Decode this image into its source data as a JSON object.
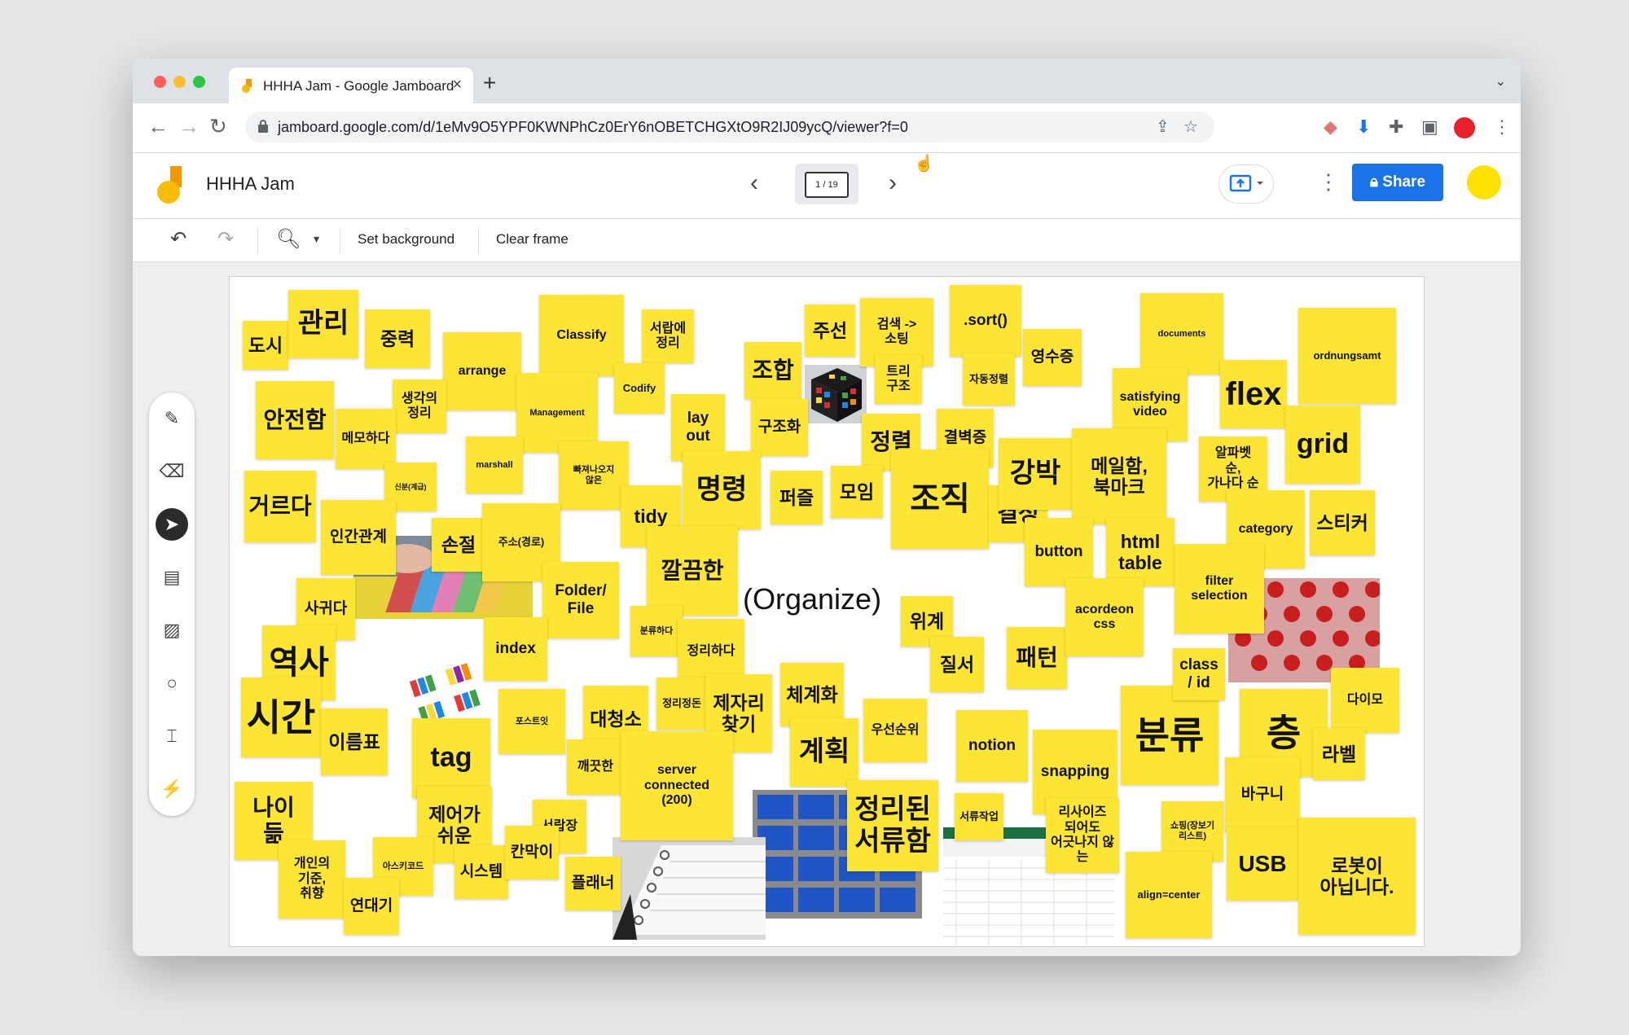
{
  "browser": {
    "tab_title": "HHHA Jam - Google Jamboard",
    "url": "jamboard.google.com/d/1eMv9O5YPF0KWNPhCz0ErY6nOBETCHGXtO9R2IJ09ycQ/viewer?f=0",
    "icons": [
      "back-icon",
      "forward-icon",
      "reload-icon",
      "lock-icon",
      "share-page-icon",
      "bookmark-star-icon",
      "extension-icon",
      "download-icon",
      "puzzle-icon",
      "sidepanel-icon",
      "profile-icon",
      "menu-icon"
    ]
  },
  "app": {
    "title": "HHHA Jam",
    "frame_indicator": "1 / 19",
    "share_label": "Share",
    "accent": "#1a73e8",
    "note_color": "#fde533"
  },
  "toolbar": {
    "set_background": "Set background",
    "clear_frame": "Clear frame"
  },
  "canvas": {
    "center_text": "(Organize)",
    "notes": [
      "도시",
      "관리",
      "중력",
      "arrange",
      "Classify",
      "서랍에\n정리",
      "Codify",
      "주선",
      "검색 ->\n소팅",
      ".sort()",
      "영수증",
      "documents",
      "ordnungsamt",
      "안전함",
      "생각의\n정리",
      "메모하다",
      "Management",
      "marshall",
      "빠져나오지\n않은",
      "lay\nout",
      "조합",
      "구조화",
      "트리\n구조",
      "자동정렬",
      "정렬",
      "결벽증",
      "satisfying\nvideo",
      "flex",
      "알파벳\n순,\n가나다 순",
      "grid",
      "거르다",
      "신분(계급)",
      "인간관계",
      "손절",
      "주소(경로)",
      "tidy",
      "명령",
      "퍼즐",
      "모임",
      "조직",
      "결성",
      "강박",
      "메일함,\n북마크",
      "button",
      "html\ntable",
      "category",
      "스티커",
      "사귀다",
      "Folder/\nFile",
      "깔끔한",
      "분류하다",
      "정리하다",
      "위계",
      "질서",
      "패턴",
      "acordeon\ncss",
      "filter\nselection",
      "역사",
      "index",
      "시간",
      "이름표",
      "tag",
      "포스트잇",
      "대청소",
      "정리정돈",
      "제자리\n찾기",
      "체계화",
      "계획",
      "우선순위",
      "notion",
      "snapping",
      "분류",
      "층",
      "class\n/ id",
      "다이모",
      "라벨",
      "나이\n듦",
      "깨끗한",
      "server\nconnected\n(200)",
      "서랍장",
      "제어가\n쉬운",
      "개인의\n기준,\n취향",
      "아스키코드",
      "시스템",
      "칸막이",
      "연대기",
      "플래너",
      "정리된\n서류함",
      "서류작업",
      "리사이즈\n되어도\n어긋나지 않는",
      "쇼핑(장보기\n리스트)",
      "align=center",
      "바구니",
      "USB",
      "로봇이\n아닙니다."
    ]
  },
  "left_tools": [
    "pen-tool-icon",
    "eraser-tool-icon",
    "select-tool-icon",
    "sticky-note-tool-icon",
    "image-tool-icon",
    "circle-tool-icon",
    "text-box-tool-icon",
    "laser-tool-icon"
  ]
}
